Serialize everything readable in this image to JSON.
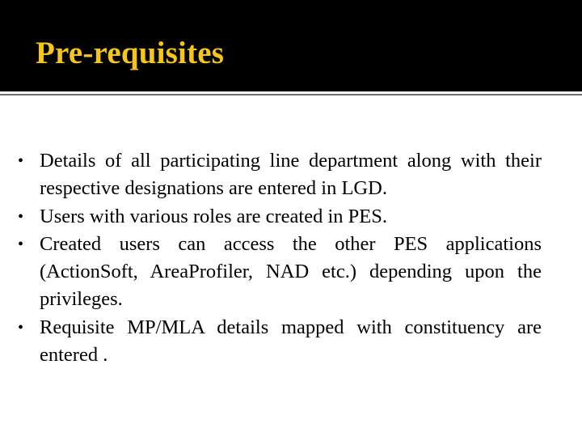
{
  "slide": {
    "title": "Pre-requisites",
    "colors": {
      "title_bar_bg": "#000000",
      "title_text": "#f5c518",
      "divider": "#6e6e6e",
      "body_text": "#000000"
    },
    "bullet_icon": "bullet-dot",
    "bullets": [
      "Details of all participating line department along with their respective designations are entered in LGD.",
      "Users with various roles are created in PES.",
      "Created users can access the other PES applications (ActionSoft, AreaProfiler, NAD etc.) depending upon the privileges.",
      "Requisite MP/MLA details mapped with constituency are entered ."
    ]
  }
}
